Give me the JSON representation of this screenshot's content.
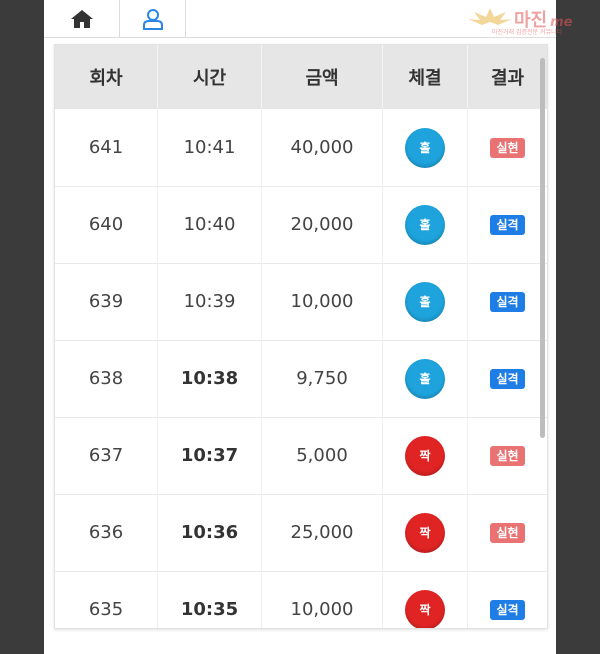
{
  "nav": {
    "tabs": [
      {
        "icon": "home-icon"
      },
      {
        "icon": "user-icon"
      }
    ]
  },
  "watermark": {
    "brand": "마진",
    "suffix": "me",
    "tagline": "마진거래 검증전문 커뮤니티"
  },
  "table": {
    "headers": [
      "회차",
      "시간",
      "금액",
      "체결",
      "결과"
    ],
    "rows": [
      {
        "round": "641",
        "time": "10:41",
        "amount": "40,000",
        "pick": "홀",
        "result": "실현"
      },
      {
        "round": "640",
        "time": "10:40",
        "amount": "20,000",
        "pick": "홀",
        "result": "실격"
      },
      {
        "round": "639",
        "time": "10:39",
        "amount": "10,000",
        "pick": "홀",
        "result": "실격"
      },
      {
        "round": "638",
        "time": "10:38",
        "amount": "9,750",
        "pick": "홀",
        "result": "실격"
      },
      {
        "round": "637",
        "time": "10:37",
        "amount": "5,000",
        "pick": "짝",
        "result": "실현"
      },
      {
        "round": "636",
        "time": "10:36",
        "amount": "25,000",
        "pick": "짝",
        "result": "실현"
      },
      {
        "round": "635",
        "time": "10:35",
        "amount": "10,000",
        "pick": "짝",
        "result": "실격"
      }
    ]
  },
  "colors": {
    "odd": "#1ea3dc",
    "even": "#e02424",
    "win": "#e97373",
    "lose": "#1f7de6",
    "header_bg": "#e6e6e6"
  }
}
